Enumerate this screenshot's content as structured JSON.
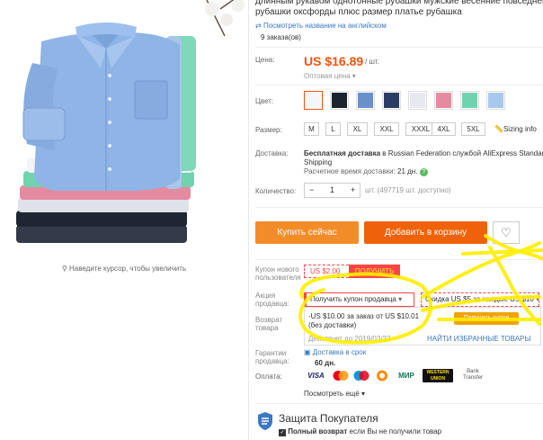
{
  "product": {
    "title_line1": "длинным рукавом однотонные рубашки мужские весенние повседнев",
    "title_line2": "рубашки оксфорды плюс размер платье рубашка",
    "translate_link": "Посмотреть название на английском",
    "orders": "9 заказа(ов)"
  },
  "gallery": {
    "zoom_hint": "Наведите курсор, чтобы увеличить"
  },
  "price": {
    "label": "Цена:",
    "value": "US $16.89",
    "unit": "/ шт.",
    "type": "Оптовая цена"
  },
  "color": {
    "label": "Цвет:",
    "swatches": [
      "#f4f6f8",
      "#1c2330",
      "#6a90cc",
      "#2b3d66",
      "#e7e9ee",
      "#e68aa0",
      "#6fd3b0",
      "#a9c8ee"
    ]
  },
  "size": {
    "label": "Размер:",
    "options": [
      "M",
      "L",
      "XL",
      "XXL",
      "XXXL",
      "4XL",
      "5XL"
    ],
    "sizing_info": "Sizing info"
  },
  "shipping": {
    "label": "Доставка:",
    "line1_bold": "Бесплатная доставка",
    "line1_rest": " в Russian Federation службой AliExpress Standard",
    "line2": "Shipping",
    "est_label": "Расчетное время доставки:",
    "est_value": "21 дн."
  },
  "quantity": {
    "label": "Количество:",
    "value": "1",
    "minus": "−",
    "plus": "+",
    "available": "шт. (497719 шт. доступно)"
  },
  "buttons": {
    "buy_now": "Купить сейчас",
    "add_to_cart": "Добавить в корзину"
  },
  "coupon": {
    "label_line1": "Купон нового",
    "label_line2": "пользователя",
    "amount": "US $2.00",
    "get": "ПОЛУЧИТЬ"
  },
  "seller_promo": {
    "label_line1": "Акция",
    "label_line2": "продавца:",
    "dropdown": "Получить купон продавца",
    "discount": "Скидка US $5 за каждые US $10",
    "popup_text": "-US $10.00 за заказ от US $10.01 (без доставки)",
    "popup_valid": "Действует до 2019/03/22",
    "popup_button": "Получить купон",
    "popup_link": "НАЙТИ ИЗБРАННЫЕ ТОВАРЫ"
  },
  "return": {
    "label_line1": "Возврат",
    "label_line2": "товара"
  },
  "guarantee": {
    "label_line1": "Гарантии",
    "label_line2": "продавца:",
    "delivery": "Доставка в срок",
    "days": "60 дн."
  },
  "payment": {
    "label": "Оплата:",
    "methods": [
      "VISA",
      "MC",
      "Maestro",
      "QIWI",
      "МИР",
      "WESTERN UNION",
      "Bank Transfer"
    ],
    "more": "Посмотреть ещё"
  },
  "protection": {
    "title": "Защита Покупателя",
    "line1_bold": "Полный возврат",
    "line1_rest": " если Вы не получили товар"
  }
}
